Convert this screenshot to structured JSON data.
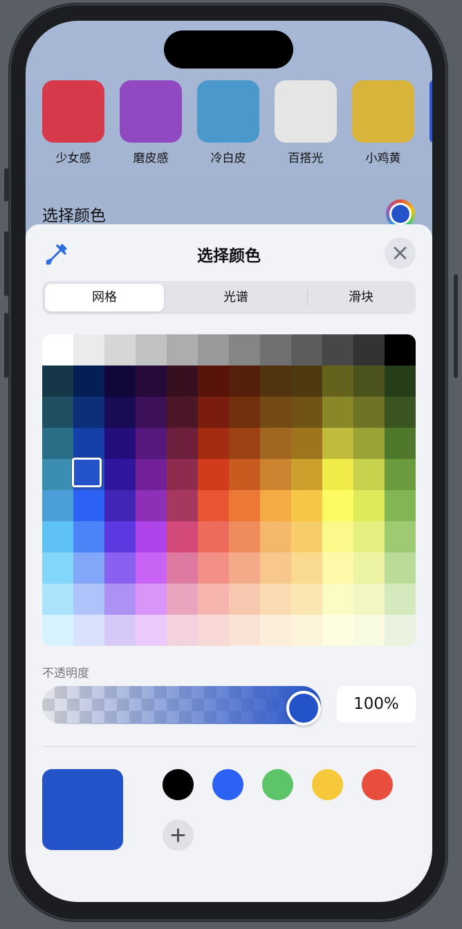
{
  "presets": [
    {
      "label": "少女感",
      "color": "#d63a4a"
    },
    {
      "label": "磨皮感",
      "color": "#9049c0"
    },
    {
      "label": "冷白皮",
      "color": "#4a98cc"
    },
    {
      "label": "百搭光",
      "color": "#e5e5e5"
    },
    {
      "label": "小鸡黄",
      "color": "#d9b43a"
    }
  ],
  "background_title": "选择颜色",
  "picker": {
    "title": "选择颜色",
    "tabs": [
      {
        "label": "网格",
        "active": true
      },
      {
        "label": "光谱",
        "active": false
      },
      {
        "label": "滑块",
        "active": false
      }
    ],
    "grid_colors": [
      [
        "#ffffff",
        "#ebebeb",
        "#d6d6d6",
        "#c2c2c2",
        "#adadad",
        "#999999",
        "#858585",
        "#707070",
        "#5c5c5c",
        "#474747",
        "#333333",
        "#000000"
      ],
      [
        "#16374a",
        "#041f55",
        "#110839",
        "#250a3a",
        "#36101e",
        "#581408",
        "#55200b",
        "#533410",
        "#4f3a0f",
        "#64621c",
        "#4b521c",
        "#263d19"
      ],
      [
        "#1e4f62",
        "#0c2f78",
        "#190c55",
        "#3c1158",
        "#4a1628",
        "#7b1d0e",
        "#73300f",
        "#754914",
        "#715315",
        "#8a8729",
        "#6f7326",
        "#3a551f"
      ],
      [
        "#296e86",
        "#1440a8",
        "#250d7b",
        "#56187d",
        "#6e1f3c",
        "#a22b10",
        "#9d4214",
        "#a16620",
        "#9e741c",
        "#c0bb3b",
        "#9aa336",
        "#50782d"
      ],
      [
        "#3b8db1",
        "#2452c8",
        "#2f169d",
        "#722098",
        "#8f2b4f",
        "#d13d1b",
        "#c75b20",
        "#cc8430",
        "#cca02c",
        "#f1eb4a",
        "#c8d24c",
        "#6a9b3d"
      ],
      [
        "#4c9ed6",
        "#2c62f3",
        "#4325b5",
        "#8e30b7",
        "#a6385f",
        "#ea5532",
        "#eb7834",
        "#f3ab45",
        "#f6c747",
        "#fdfb62",
        "#dfea5a",
        "#81b652"
      ],
      [
        "#5ec3f4",
        "#4b84f6",
        "#5b38df",
        "#ad43e8",
        "#d3497a",
        "#ed6b5b",
        "#f08c5c",
        "#f5b76c",
        "#f7cd6a",
        "#fcf98b",
        "#e6f080",
        "#9ecb72"
      ],
      [
        "#82d6fa",
        "#82a7f8",
        "#8a60f0",
        "#c863f6",
        "#de7aa1",
        "#f29085",
        "#f4a989",
        "#f7c78c",
        "#f9da8e",
        "#fcf9a9",
        "#ecf3a2",
        "#bbdc98"
      ],
      [
        "#acE3fc",
        "#aec3fa",
        "#ae92f3",
        "#d995f9",
        "#e9a4be",
        "#f5b5ae",
        "#f7c8b0",
        "#f9dab1",
        "#fbe6b3",
        "#fdfbc5",
        "#f2f6c2",
        "#d4e9be"
      ],
      [
        "#d5f2fe",
        "#d8e2fd",
        "#d6c9f8",
        "#ecc9fc",
        "#f3d1dd",
        "#f9d9d6",
        "#fae3d6",
        "#fceed8",
        "#fdf3d9",
        "#fefde2",
        "#f8fbe1",
        "#e9f3df"
      ]
    ],
    "selected_color": "#2452c8",
    "opacity_label": "不透明度",
    "opacity_percent": 100,
    "opacity_value": "100%",
    "favorites": [
      "#000000",
      "#2c62f3",
      "#5ec46a",
      "#f8c83c",
      "#e84d3d"
    ]
  }
}
